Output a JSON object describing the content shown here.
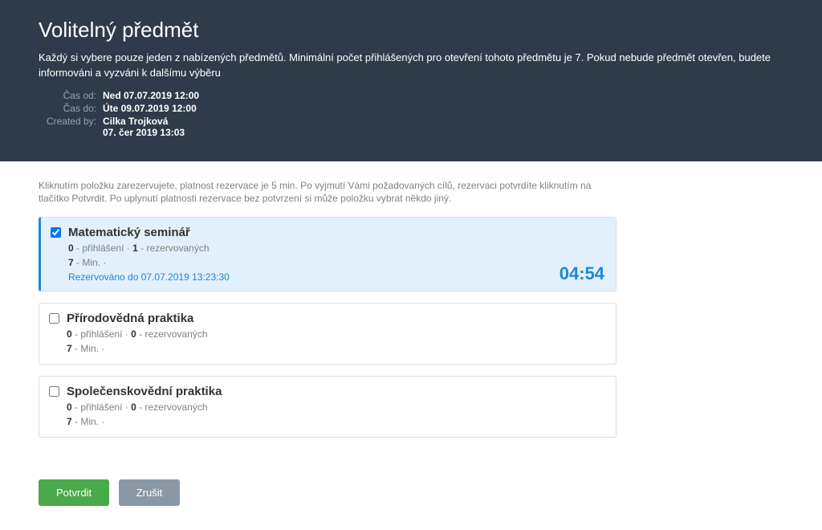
{
  "header": {
    "title": "Volitelný předmět",
    "description": "Každý si vybere pouze jeden z nabízených předmětů. Minimální počet přihlášených pro otevření tohoto předmětu je 7. Pokud nebude předmět otevřen, budete informováni a vyzváni k dalšímu výběru",
    "meta": [
      {
        "label": "Čas od:",
        "value": "Ned 07.07.2019 12:00"
      },
      {
        "label": "Čas do:",
        "value": "Úte 09.07.2019 12:00"
      },
      {
        "label": "Created by:",
        "value": "Cilka Trojková\n07. čer 2019 13:03"
      }
    ]
  },
  "hint": "Kliknutím položku zarezervujete, platnost rezervace je 5 min. Po vyjmutí Vámi požadovaných cílů, rezervaci potvrdíte kliknutím na tlačítko Potvrdit. Po uplynutí platnosti rezervace bez potvrzení si může položku vybrat někdo jiný.",
  "stat_labels": {
    "signed": "přihlášení",
    "reserved": "rezervovaných",
    "min": "Min."
  },
  "items": [
    {
      "title": "Matematický seminář",
      "signed": "0",
      "reserved": "1",
      "min": "7",
      "selected": true,
      "reserve_line": "Rezervováno do 07.07.2019 13:23:30",
      "timer": "04:54"
    },
    {
      "title": "Přírodovědná praktika",
      "signed": "0",
      "reserved": "0",
      "min": "7",
      "selected": false
    },
    {
      "title": "Společenskovědní praktika",
      "signed": "0",
      "reserved": "0",
      "min": "7",
      "selected": false
    }
  ],
  "buttons": {
    "confirm": "Potvrdit",
    "cancel": "Zrušit"
  }
}
